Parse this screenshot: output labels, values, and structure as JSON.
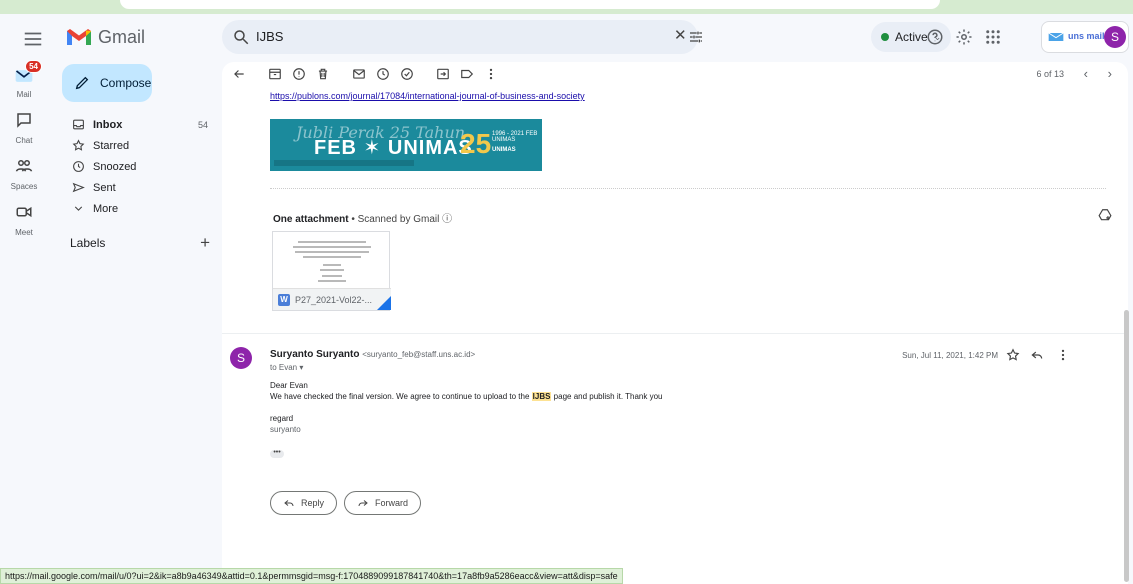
{
  "app": {
    "name": "Gmail"
  },
  "search": {
    "query": "IJBS",
    "clear_label": "✕"
  },
  "status_pill": {
    "label": "Active"
  },
  "account": {
    "brand": "uns mail",
    "avatar_letter": "S"
  },
  "rail": {
    "mail_label": "Mail",
    "mail_badge": "54",
    "chat_label": "Chat",
    "spaces_label": "Spaces",
    "meet_label": "Meet"
  },
  "compose": {
    "label": "Compose"
  },
  "nav": {
    "items": [
      {
        "label": "Inbox",
        "count": "54"
      },
      {
        "label": "Starred"
      },
      {
        "label": "Snoozed"
      },
      {
        "label": "Sent"
      },
      {
        "label": "More"
      }
    ]
  },
  "labels": {
    "title": "Labels",
    "add": "+"
  },
  "toolbar": {
    "pager": "6 of 13"
  },
  "message1": {
    "link": "https://publons.com/journal/17084/international-journal-of-business-and-society",
    "banner_script": "Jubli Perak 25 Tahun",
    "banner_title": "FEB ✶ UNIMAS",
    "banner_num": "25",
    "banner_small": "1996 - 2021 FEB UNIMAS",
    "banner_small2": "UNIMAS",
    "attach_count": "One attachment",
    "attach_scan": " • Scanned by Gmail ⓘ",
    "file_type": "W",
    "file_name": "P27_2021-Vol22-..."
  },
  "message2": {
    "avatar_letter": "S",
    "sender_name": "Suryanto Suryanto",
    "sender_email": "<suryanto_feb@staff.uns.ac.id>",
    "to": "to Evan ▾",
    "date": "Sun, Jul 11, 2021, 1:42 PM",
    "greeting": "Dear Evan",
    "line_pre": "We have checked the final version. We agree to continue to upload to the ",
    "line_hl": "IJBS",
    "line_post": " page and publish it. Thank you",
    "sign1": "regard",
    "sign2": "suryanto",
    "more": "•••"
  },
  "actions": {
    "reply": "Reply",
    "forward": "Forward"
  },
  "statusbar": {
    "url": "https://mail.google.com/mail/u/0?ui=2&ik=a8b9a46349&attid=0.1&permmsgid=msg-f:1704889099187841740&th=17a8fb9a5286eacc&view=att&disp=safe"
  }
}
